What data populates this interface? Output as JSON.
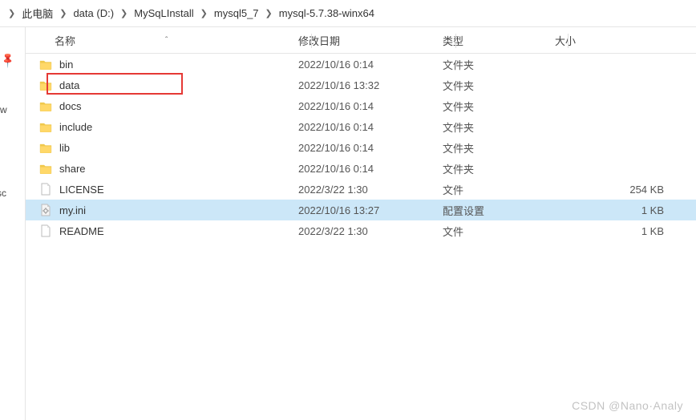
{
  "breadcrumb": {
    "items": [
      {
        "label": "此电脑"
      },
      {
        "label": "data (D:)"
      },
      {
        "label": "MySqLInstall"
      },
      {
        "label": "mysql5_7"
      },
      {
        "label": "mysql-5.7.38-winx64"
      }
    ]
  },
  "sidebar": {
    "cut1": ")-w",
    "cut2": "rsc"
  },
  "columns": {
    "name": "名称",
    "date": "修改日期",
    "type": "类型",
    "size": "大小"
  },
  "files": [
    {
      "icon": "folder",
      "name": "bin",
      "date": "2022/10/16 0:14",
      "type": "文件夹",
      "size": ""
    },
    {
      "icon": "folder",
      "name": "data",
      "date": "2022/10/16 13:32",
      "type": "文件夹",
      "size": "",
      "highlighted": true
    },
    {
      "icon": "folder",
      "name": "docs",
      "date": "2022/10/16 0:14",
      "type": "文件夹",
      "size": ""
    },
    {
      "icon": "folder",
      "name": "include",
      "date": "2022/10/16 0:14",
      "type": "文件夹",
      "size": ""
    },
    {
      "icon": "folder",
      "name": "lib",
      "date": "2022/10/16 0:14",
      "type": "文件夹",
      "size": ""
    },
    {
      "icon": "folder",
      "name": "share",
      "date": "2022/10/16 0:14",
      "type": "文件夹",
      "size": ""
    },
    {
      "icon": "file",
      "name": "LICENSE",
      "date": "2022/3/22 1:30",
      "type": "文件",
      "size": "254 KB"
    },
    {
      "icon": "ini",
      "name": "my.ini",
      "date": "2022/10/16 13:27",
      "type": "配置设置",
      "size": "1 KB",
      "selected": true
    },
    {
      "icon": "file",
      "name": "README",
      "date": "2022/3/22 1:30",
      "type": "文件",
      "size": "1 KB"
    }
  ],
  "watermark": "CSDN @Nano·Analy"
}
